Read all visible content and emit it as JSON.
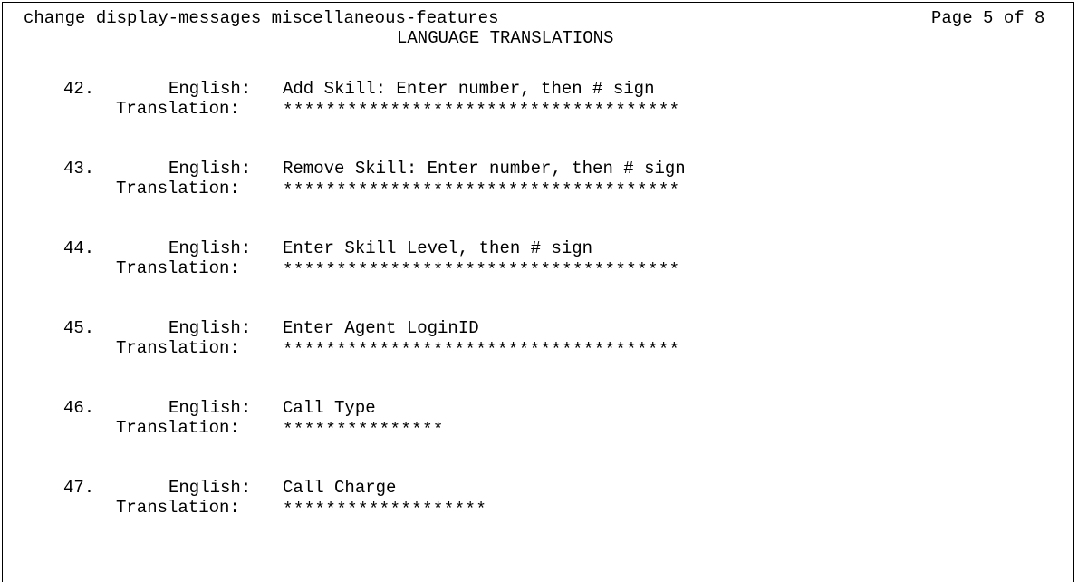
{
  "header": {
    "command": "change display-messages miscellaneous-features",
    "page": "Page 5 of 8",
    "subtitle": "LANGUAGE TRANSLATIONS"
  },
  "labels": {
    "english": "English:",
    "translation": "Translation:"
  },
  "entries": [
    {
      "number": "42.",
      "english": "Add Skill: Enter number, then # sign",
      "translation": "*************************************"
    },
    {
      "number": "43.",
      "english": "Remove Skill: Enter number, then # sign",
      "translation": "*************************************"
    },
    {
      "number": "44.",
      "english": "Enter Skill Level, then # sign",
      "translation": "*************************************"
    },
    {
      "number": "45.",
      "english": "Enter Agent LoginID",
      "translation": "*************************************"
    },
    {
      "number": "46.",
      "english": "Call Type",
      "translation": "***************"
    },
    {
      "number": "47.",
      "english": "Call Charge",
      "translation": "*******************"
    }
  ]
}
